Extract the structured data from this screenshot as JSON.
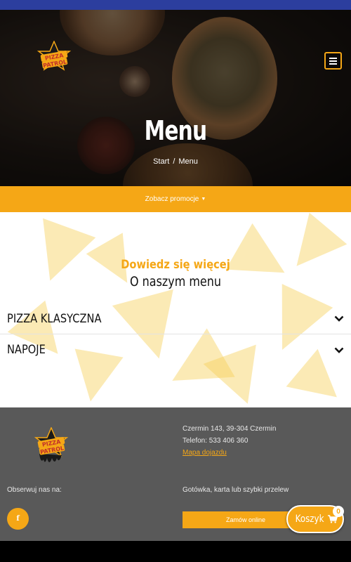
{
  "header": {
    "brand_line1": "PIZZA",
    "brand_line2": "PATROL",
    "menu_icon": "bars-icon"
  },
  "hero": {
    "title": "Menu",
    "breadcrumb": {
      "home": "Start",
      "separator": "/",
      "current": "Menu"
    }
  },
  "promo": {
    "label": "Zobacz promocje",
    "icon": "caret-down-icon"
  },
  "section": {
    "subheading": "Dowiedz się więcej",
    "heading": "O naszym menu",
    "categories": [
      {
        "label": "PIZZA KLASYCZNA",
        "icon": "chevron-down-icon"
      },
      {
        "label": "NAPOJE",
        "icon": "chevron-down-icon"
      }
    ]
  },
  "footer": {
    "address": "Czermin 143, 39-304 Czermin",
    "phone": "Telefon: 533 406 360",
    "map_link": "Mapa dojazdu",
    "follow_label": "Obserwuj nas na:",
    "payments": "Gotówka, karta lub szybki przelew",
    "facebook_icon": "facebook-icon",
    "order_button": "Zamów online"
  },
  "cart": {
    "label": "Koszyk",
    "count": "0",
    "icon": "cart-icon"
  },
  "colors": {
    "accent": "#f5a716",
    "topbar": "#2c3e9e",
    "footer": "#595959"
  }
}
